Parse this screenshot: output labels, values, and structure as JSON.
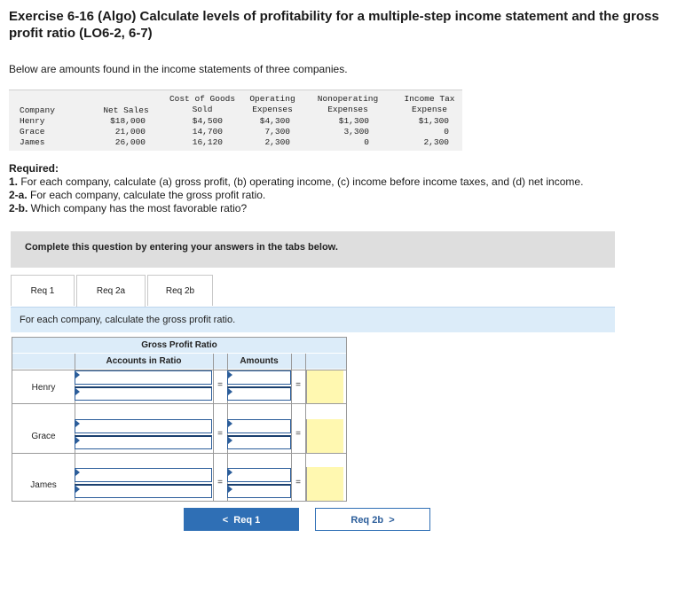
{
  "title": "Exercise 6-16 (Algo) Calculate levels of profitability for a multiple-step income statement and the gross profit ratio (LO6-2, 6-7)",
  "intro": "Below are amounts found in the income statements of three companies.",
  "data_table": {
    "headers": {
      "company": "Company",
      "net_sales": "Net Sales",
      "cogs_1": "Cost of Goods",
      "cogs_2": "Sold",
      "opex_1": "Operating",
      "opex_2": "Expenses",
      "nonop_1": "Nonoperating",
      "nonop_2": "Expenses",
      "tax_1": "Income Tax",
      "tax_2": "Expense"
    },
    "rows": [
      {
        "company": "Henry",
        "net_sales": "$18,000",
        "cogs": "$4,500",
        "opex": "$4,300",
        "nonop": "$1,300",
        "tax": "$1,300"
      },
      {
        "company": "Grace",
        "net_sales": "21,000",
        "cogs": "14,700",
        "opex": "7,300",
        "nonop": "3,300",
        "tax": "0"
      },
      {
        "company": "James",
        "net_sales": "26,000",
        "cogs": "16,120",
        "opex": "2,300",
        "nonop": "0",
        "tax": "2,300"
      }
    ]
  },
  "required": {
    "heading": "Required:",
    "items": [
      {
        "prefix": "1.",
        "text": " For each company, calculate (a) gross profit, (b) operating income, (c) income before income taxes, and (d) net income."
      },
      {
        "prefix": "2-a.",
        "text": " For each company, calculate the gross profit ratio."
      },
      {
        "prefix": "2-b.",
        "text": " Which company has the most favorable ratio?"
      }
    ]
  },
  "instruction_bar": "Complete this question by entering your answers in the tabs below.",
  "tabs": [
    {
      "label": "Req 1",
      "active": false
    },
    {
      "label": "Req 2a",
      "active": true
    },
    {
      "label": "Req 2b",
      "active": false
    }
  ],
  "panel_instruction": "For each company, calculate the gross profit ratio.",
  "grid": {
    "header_main": "Gross Profit Ratio",
    "col_accounts": "Accounts in Ratio",
    "col_amounts": "Amounts",
    "equals": "=",
    "companies": [
      "Henry",
      "Grace",
      "James"
    ]
  },
  "buttons": {
    "prev_label": "Req 1",
    "prev_arrow": "<",
    "next_label": "Req 2b",
    "next_arrow": ">"
  },
  "colors": {
    "accent": "#2f6fb5",
    "header_bg": "#dcecf9",
    "answer_cell": "#fff8b0"
  }
}
